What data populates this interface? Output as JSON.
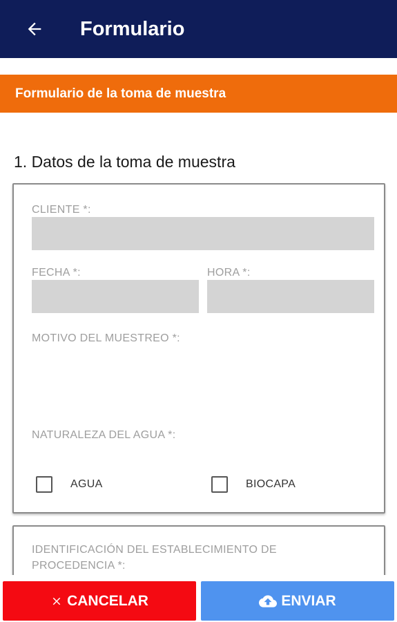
{
  "appbar": {
    "title": "Formulario",
    "back_icon": "arrow-left-icon"
  },
  "banner": {
    "text": "Formulario de la toma de muestra",
    "color": "#ef6c0c"
  },
  "section": {
    "heading": "1. Datos de la toma de muestra"
  },
  "form": {
    "cliente": {
      "label": "CLIENTE *:",
      "value": ""
    },
    "fecha": {
      "label": "FECHA *:",
      "value": ""
    },
    "hora": {
      "label": "HORA *:",
      "value": ""
    },
    "motivo": {
      "label": "MOTIVO DEL MUESTREO *:"
    },
    "naturaleza": {
      "label": "NATURALEZA DEL AGUA *:",
      "options": [
        {
          "label": "AGUA",
          "checked": false
        },
        {
          "label": "BIOCAPA",
          "checked": false
        }
      ]
    },
    "identificacion": {
      "label_line1": "IDENTIFICACIÓN DEL ESTABLECIMIENTO DE",
      "label_line2": "PROCEDENCIA *:"
    }
  },
  "actions": {
    "cancel_label": "CANCELAR",
    "send_label": "ENVIAR",
    "cancel_color": "#f40a12",
    "send_color": "#4f93ef",
    "cancel_icon": "close-icon",
    "send_icon": "cloud-upload-icon"
  },
  "colors": {
    "appbar": "#0f1d59",
    "field_bg": "#d4d4d4"
  }
}
